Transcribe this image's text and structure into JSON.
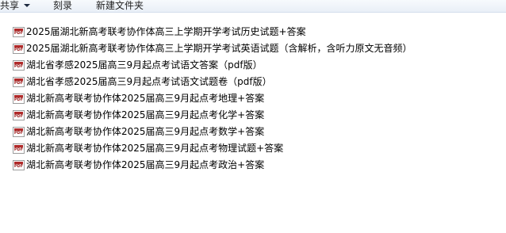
{
  "toolbar": {
    "share_label": "共享",
    "burn_label": "刻录",
    "new_folder_label": "新建文件夹"
  },
  "icons": {
    "file_type": "pdf-file-icon",
    "icon_badge_text": "PDF"
  },
  "files": [
    {
      "name": "2025届湖北新高考联考协作体高三上学期开学考试历史试题+答案"
    },
    {
      "name": "2025届湖北新高考联考协作体高三上学期开学考试英语试题（含解析，含听力原文无音频）"
    },
    {
      "name": "湖北省孝感2025届高三9月起点考试语文答案（pdf版）"
    },
    {
      "name": "湖北省孝感2025届高三9月起点考试语文试题卷（pdf版）"
    },
    {
      "name": "湖北新高考联考协作体2025届高三9月起点考地理+答案"
    },
    {
      "name": "湖北新高考联考协作体2025届高三9月起点考化学+答案"
    },
    {
      "name": "湖北新高考联考协作体2025届高三9月起点考数学+答案"
    },
    {
      "name": "湖北新高考联考协作体2025届高三9月起点考物理试题+答案"
    },
    {
      "name": "湖北新高考联考协作体2025届高三9月起点考政治+答案"
    }
  ]
}
